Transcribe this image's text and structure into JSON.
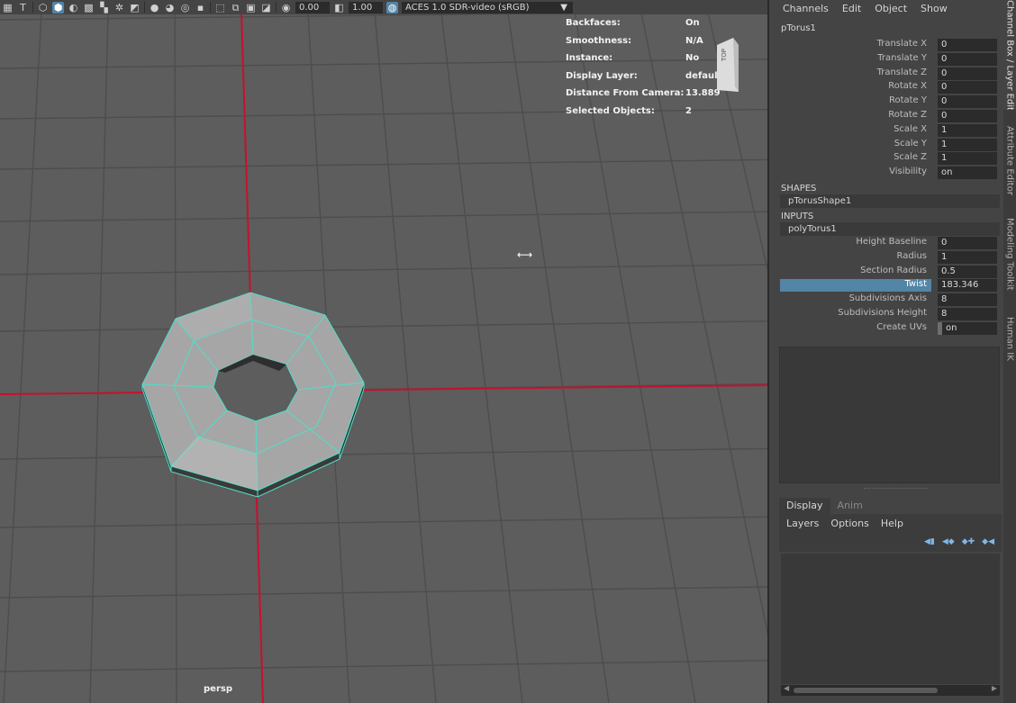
{
  "toolbar": {
    "exposure_value": "0.00",
    "gamma_value": "1.00",
    "color_space": "ACES 1.0 SDR-video (sRGB)"
  },
  "hud": [
    {
      "label": "Backfaces:",
      "value": "On"
    },
    {
      "label": "Smoothness:",
      "value": "N/A"
    },
    {
      "label": "Instance:",
      "value": "No"
    },
    {
      "label": "Display Layer:",
      "value": "default"
    },
    {
      "label": "Distance From Camera:",
      "value": "13.889"
    },
    {
      "label": "Selected Objects:",
      "value": "2"
    }
  ],
  "viewcube_label": "TOP",
  "camera_label": "persp",
  "channel_box": {
    "menu": [
      "Channels",
      "Edit",
      "Object",
      "Show"
    ],
    "object_name": "pTorus1",
    "transform": [
      {
        "label": "Translate X",
        "value": "0"
      },
      {
        "label": "Translate Y",
        "value": "0"
      },
      {
        "label": "Translate Z",
        "value": "0"
      },
      {
        "label": "Rotate X",
        "value": "0"
      },
      {
        "label": "Rotate Y",
        "value": "0"
      },
      {
        "label": "Rotate Z",
        "value": "0"
      },
      {
        "label": "Scale X",
        "value": "1"
      },
      {
        "label": "Scale Y",
        "value": "1"
      },
      {
        "label": "Scale Z",
        "value": "1"
      },
      {
        "label": "Visibility",
        "value": "on"
      }
    ],
    "shapes_heading": "SHAPES",
    "shape_node": "pTorusShape1",
    "inputs_heading": "INPUTS",
    "input_node": "polyTorus1",
    "inputs": [
      {
        "label": "Height Baseline",
        "value": "0"
      },
      {
        "label": "Radius",
        "value": "1"
      },
      {
        "label": "Section Radius",
        "value": "0.5"
      },
      {
        "label": "Twist",
        "value": "183.346"
      },
      {
        "label": "Subdivisions Axis",
        "value": "8"
      },
      {
        "label": "Subdivisions Height",
        "value": "8"
      },
      {
        "label": "Create UVs",
        "value": "on"
      }
    ]
  },
  "layer_editor": {
    "tabs": [
      "Display",
      "Anim"
    ],
    "menu": [
      "Layers",
      "Options",
      "Help"
    ]
  },
  "side_tabs": [
    "Channel Box / Layer Editor",
    "Attribute Editor",
    "Modeling Toolkit",
    "Human IK"
  ],
  "colors": {
    "viewport_bg": "#5d5d5d",
    "grid_line": "#4a4a4a",
    "axis_line": "#c8102e",
    "wireframe": "#4fe0c8",
    "highlight": "#5285a6"
  }
}
